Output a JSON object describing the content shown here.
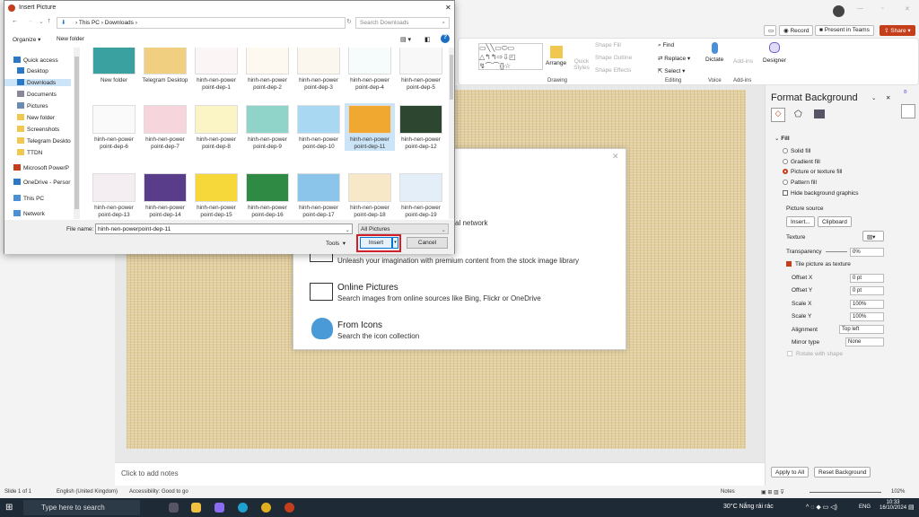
{
  "ribbon": {
    "record": "Record",
    "present": "Present in Teams",
    "share": "Share",
    "arrange": "Arrange",
    "quick_styles": "Quick Styles",
    "shape_fill": "Shape Fill",
    "shape_outline": "Shape Outline",
    "shape_effects": "Shape Effects",
    "find": "Find",
    "replace": "Replace",
    "select": "Select",
    "dictate": "Dictate",
    "addins": "Add-ins",
    "designer": "Designer",
    "groups": {
      "drawing": "Drawing",
      "editing": "Editing",
      "voice": "Voice",
      "addins": "Add-ins"
    }
  },
  "insert_pictures": {
    "network_text": "al network",
    "stock_desc": "Unleash your imagination with premium content from the stock image library",
    "online_title": "Online Pictures",
    "online_desc": "Search images from online sources like Bing, Flickr or OneDrive",
    "icons_title": "From Icons",
    "icons_desc": "Search the icon collection"
  },
  "dialog": {
    "title": "Insert Picture",
    "breadcrumb": [
      "This PC",
      "Downloads"
    ],
    "search_placeholder": "Search Downloads",
    "organize": "Organize",
    "new_folder": "New folder",
    "nav": [
      {
        "label": "Quick access",
        "icon": "star"
      },
      {
        "label": "Desktop",
        "icon": "desktop"
      },
      {
        "label": "Downloads",
        "icon": "download",
        "selected": true
      },
      {
        "label": "Documents",
        "icon": "document"
      },
      {
        "label": "Pictures",
        "icon": "picture"
      },
      {
        "label": "New folder",
        "icon": "folder"
      },
      {
        "label": "Screenshots",
        "icon": "folder"
      },
      {
        "label": "Telegram Deskto",
        "icon": "folder"
      },
      {
        "label": "TTDN",
        "icon": "folder"
      },
      {
        "label": "Microsoft PowerP",
        "icon": "powerpoint"
      },
      {
        "label": "OneDrive - Persor",
        "icon": "onedrive"
      },
      {
        "label": "This PC",
        "icon": "pc"
      },
      {
        "label": "Network",
        "icon": "network"
      }
    ],
    "files": [
      {
        "name": "New folder",
        "color": "#3aa0a0"
      },
      {
        "name": "Telegram Desktop",
        "color": "#f0d080"
      },
      {
        "name": "hinh-nen-power point-dep-1",
        "color": "#fbf5f5"
      },
      {
        "name": "hinh-nen-power point-dep-2",
        "color": "#fdf8f0"
      },
      {
        "name": "hinh-nen-power point-dep-3",
        "color": "#fbf7ee"
      },
      {
        "name": "hinh-nen-power point-dep-4",
        "color": "#f6fbfb"
      },
      {
        "name": "hinh-nen-power point-dep-5",
        "color": "#f8f8f8"
      },
      {
        "name": "hinh-nen-power point-dep-6",
        "color": "#fafafa"
      },
      {
        "name": "hinh-nen-power point-dep-7",
        "color": "#f6d6dc"
      },
      {
        "name": "hinh-nen-power point-dep-8",
        "color": "#fbf4c4"
      },
      {
        "name": "hinh-nen-power point-dep-9",
        "color": "#8fd3c9"
      },
      {
        "name": "hinh-nen-power point-dep-10",
        "color": "#a9d8f3"
      },
      {
        "name": "hinh-nen-power point-dep-11",
        "color": "#f0a830",
        "selected": true
      },
      {
        "name": "hinh-nen-power point-dep-12",
        "color": "#2d4630"
      },
      {
        "name": "hinh-nen-power point-dep-13",
        "color": "#f4eef2"
      },
      {
        "name": "hinh-nen-power point-dep-14",
        "color": "#5a3d8a"
      },
      {
        "name": "hinh-nen-power point-dep-15",
        "color": "#f6d83a"
      },
      {
        "name": "hinh-nen-power point-dep-16",
        "color": "#2f8a43"
      },
      {
        "name": "hinh-nen-power point-dep-17",
        "color": "#8cc5ea"
      },
      {
        "name": "hinh-nen-power point-dep-18",
        "color": "#f7e8c8"
      },
      {
        "name": "hinh-nen-power point-dep-19",
        "color": "#e4eef8"
      }
    ],
    "file_name_label": "File name:",
    "file_name_value": "hinh-nen-powerpoint-dep-11",
    "file_type": "All Pictures",
    "tools": "Tools",
    "insert": "Insert",
    "cancel": "Cancel"
  },
  "format_background": {
    "title": "Format Background",
    "section": "Fill",
    "solid": "Solid fill",
    "gradient": "Gradient fill",
    "picture": "Picture or texture fill",
    "pattern": "Pattern fill",
    "hide_bg": "Hide background graphics",
    "picture_source": "Picture source",
    "insert": "Insert...",
    "clipboard": "Clipboard",
    "texture": "Texture",
    "transparency": "Transparency",
    "transparency_value": "0%",
    "tile": "Tile picture as texture",
    "offset_x": "Offset X",
    "offset_x_value": "0 pt",
    "offset_y": "Offset Y",
    "offset_y_value": "0 pt",
    "scale_x": "Scale X",
    "scale_x_value": "100%",
    "scale_y": "Scale Y",
    "scale_y_value": "100%",
    "alignment": "Alignment",
    "alignment_value": "Top left",
    "mirror": "Mirror type",
    "mirror_value": "None",
    "rotate": "Rotate with shape",
    "apply_all": "Apply to All",
    "reset": "Reset Background"
  },
  "notes": {
    "placeholder": "Click to add notes"
  },
  "status": {
    "slide": "Slide 1 of 1",
    "language": "English (United Kingdom)",
    "accessibility": "Accessibility: Good to go",
    "notes": "Notes",
    "zoom": "102%"
  },
  "taskbar": {
    "search": "Type here to search",
    "weather": "30°C  Nắng rải rác",
    "lang": "ENG",
    "time": "10:33",
    "date": "16/10/2024"
  },
  "colors": {
    "accent": "#c43e1c",
    "highlight": "#cce4f7",
    "insert_outline": "#d0202a"
  }
}
